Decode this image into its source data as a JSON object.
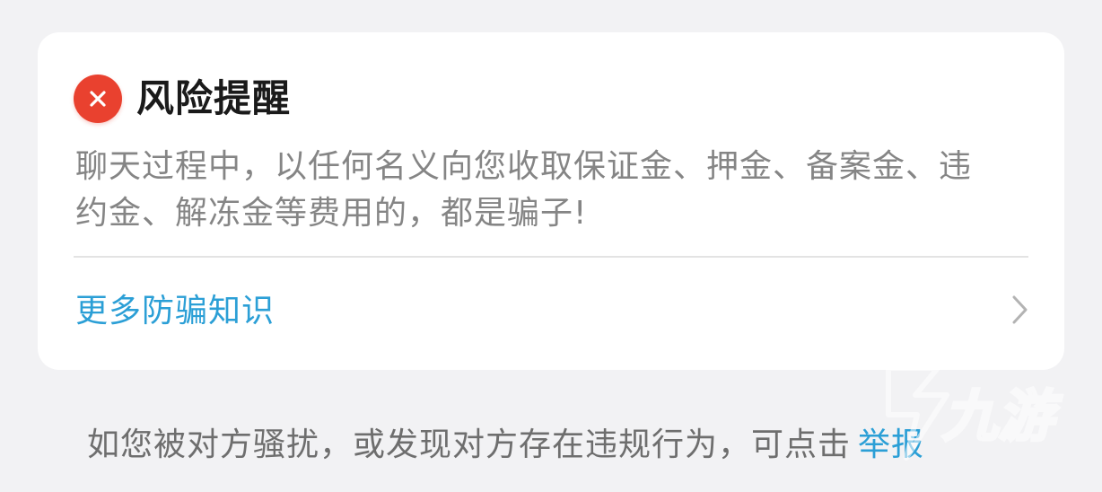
{
  "alert": {
    "icon": "close-icon",
    "icon_color": "#e9412f",
    "title": "风险提醒",
    "message": "聊天过程中，以任何名义向您收取保证金、押金、备案金、违约金、解冻金等费用的，都是骗子!",
    "more_link_label": "更多防骗知识",
    "more_link_icon": "chevron-right-icon"
  },
  "footer": {
    "text": "如您被对方骚扰，或发现对方存在违规行为，可点击",
    "report_label": "举报"
  },
  "colors": {
    "background": "#f2f2f4",
    "card": "#ffffff",
    "link": "#2b9fd6",
    "body_text": "#858585"
  },
  "watermark": {
    "text": "九游"
  }
}
